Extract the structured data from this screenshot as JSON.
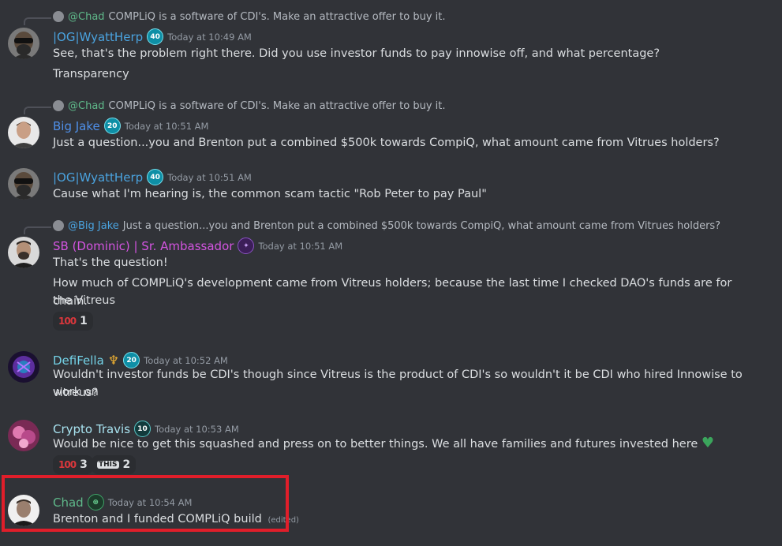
{
  "messages": [
    {
      "reply": {
        "name": "@Chad",
        "text": "COMPLiQ is a software of CDI's. Make an attractive offer to buy it."
      },
      "user": "|OG|WyattHerp",
      "badge": "40",
      "time": "Today at 10:49 AM",
      "lines": [
        "See, that's the problem right there. Did you use investor funds to pay innowise off, and what percentage?",
        "Transparency"
      ]
    },
    {
      "reply": {
        "name": "@Chad",
        "text": "COMPLiQ is a software of CDI's. Make an attractive offer to buy it."
      },
      "user": "Big Jake",
      "badge": "20",
      "time": "Today at 10:51 AM",
      "lines": [
        "Just a question...you and Brenton put a combined $500k towards CompiQ, what amount came from Vitrues holders?"
      ]
    },
    {
      "user": "|OG|WyattHerp",
      "badge": "40",
      "time": "Today at 10:51 AM",
      "lines": [
        "Cause what I'm hearing is, the common scam tactic \"Rob Peter to pay Paul\""
      ]
    },
    {
      "reply": {
        "name": "@Big Jake",
        "text": "Just a question...you and Brenton put a combined $500k towards CompiQ, what amount came from Vitrues holders?"
      },
      "user": "SB (Dominic) | Sr. Ambassador",
      "time": "Today at 10:51 AM",
      "lines": [
        "That's the question!",
        "How much of COMPLiQ's development came from Vitreus holders; because the last time I checked DAO's funds are for the Vitreus",
        "chain."
      ],
      "reactions": [
        {
          "emoji": "100",
          "count": "1"
        }
      ]
    },
    {
      "user": "DefiFella",
      "badge": "20",
      "time": "Today at 10:52 AM",
      "lines": [
        "Wouldn't investor funds be CDI's though since Vitreus is the product of CDI's so wouldn't it be CDI who hired Innowise to work on",
        "vitreus?"
      ]
    },
    {
      "user": "Crypto Travis",
      "badge": "10",
      "time": "Today at 10:53 AM",
      "lines": [
        "Would be nice to get this squashed and press on to better things. We all have families and futures invested here"
      ],
      "reactions": [
        {
          "emoji": "100",
          "count": "3"
        },
        {
          "emoji": "THIS",
          "count": "2"
        }
      ]
    },
    {
      "user": "Chad",
      "time": "Today at 10:54 AM",
      "lines": [
        "Brenton and I funded COMPLiQ build"
      ],
      "edited": "(edited)"
    }
  ],
  "colors": {
    "background": "#313338",
    "highlight": "#e01e2a",
    "wyatt": "#4aa3df",
    "jake": "#4f8fe8",
    "sb": "#d354e0",
    "defi": "#74d3e8",
    "travis": "#a8e3f0",
    "chad": "#5fb98a"
  },
  "icons": {
    "heart": "green-heart-icon",
    "trident": "trident-icon"
  }
}
